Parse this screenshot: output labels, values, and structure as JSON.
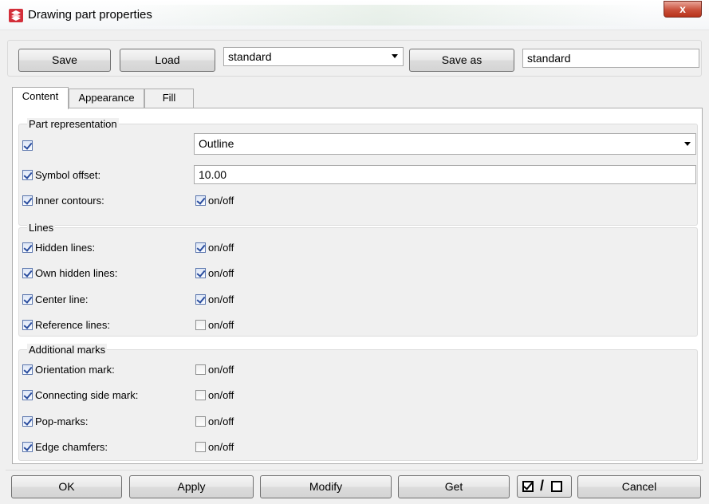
{
  "window": {
    "title": "Drawing part properties",
    "close_label": "x"
  },
  "toolbar": {
    "save_label": "Save",
    "load_label": "Load",
    "preset_select_value": "standard",
    "save_as_label": "Save as",
    "save_as_value": "standard"
  },
  "tabs": [
    {
      "label": "Content",
      "active": true
    },
    {
      "label": "Appearance",
      "active": false
    },
    {
      "label": "Fill",
      "active": false
    }
  ],
  "part_representation": {
    "title": "Part representation",
    "representation_checked": true,
    "representation_value": "Outline",
    "symbol_offset_label": "Symbol offset:",
    "symbol_offset_checked": true,
    "symbol_offset_value": "10.00",
    "inner_contours_label": "Inner contours:",
    "inner_contours_checked": true,
    "inner_contours_onoff_label": "on/off",
    "inner_contours_onoff_checked": true
  },
  "lines": {
    "title": "Lines",
    "rows": [
      {
        "label": "Hidden lines:",
        "checked": true,
        "toggle_label": "on/off",
        "toggle_checked": true
      },
      {
        "label": "Own hidden lines:",
        "checked": true,
        "toggle_label": "on/off",
        "toggle_checked": true
      },
      {
        "label": "Center line:",
        "checked": true,
        "toggle_label": "on/off",
        "toggle_checked": true
      },
      {
        "label": "Reference lines:",
        "checked": true,
        "toggle_label": "on/off",
        "toggle_checked": false
      }
    ]
  },
  "additional_marks": {
    "title": "Additional marks",
    "rows": [
      {
        "label": "Orientation mark:",
        "checked": true,
        "toggle_label": "on/off",
        "toggle_checked": false
      },
      {
        "label": "Connecting side mark:",
        "checked": true,
        "toggle_label": "on/off",
        "toggle_checked": false
      },
      {
        "label": "Pop-marks:",
        "checked": true,
        "toggle_label": "on/off",
        "toggle_checked": false
      },
      {
        "label": "Edge chamfers:",
        "checked": true,
        "toggle_label": "on/off",
        "toggle_checked": false
      }
    ]
  },
  "bottom": {
    "ok_label": "OK",
    "apply_label": "Apply",
    "modify_label": "Modify",
    "get_label": "Get",
    "cancel_label": "Cancel"
  },
  "colors": {
    "close_button": "#c9503b",
    "checkbox_check": "#2a4d9e",
    "app_icon": "#d32f3a"
  }
}
